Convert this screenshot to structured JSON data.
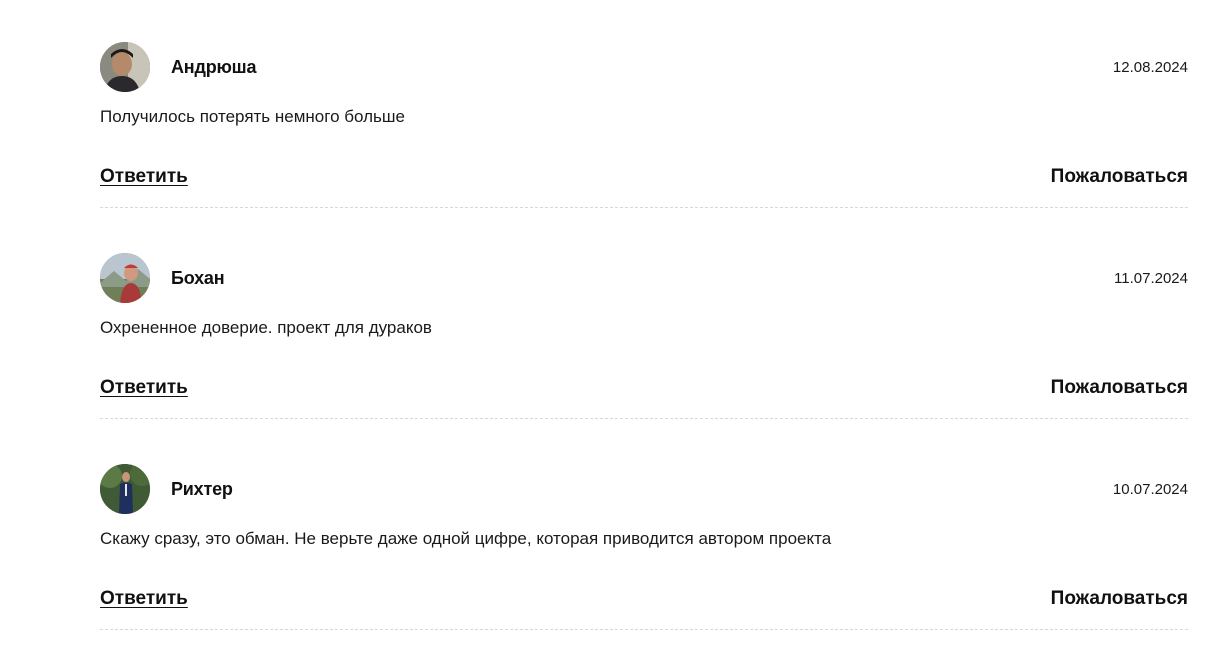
{
  "comments": [
    {
      "author": "Андрюша",
      "date": "12.08.2024",
      "text": "Получилось потерять немного больше",
      "reply_label": "Ответить",
      "report_label": "Пожаловаться"
    },
    {
      "author": "Бохан",
      "date": "11.07.2024",
      "text": "Охрененное доверие. проект для дураков",
      "reply_label": "Ответить",
      "report_label": "Пожаловаться"
    },
    {
      "author": "Рихтер",
      "date": "10.07.2024",
      "text": "Скажу сразу, это обман. Не верьте даже одной цифре, которая приводится автором проекта",
      "reply_label": "Ответить",
      "report_label": "Пожаловаться"
    }
  ]
}
